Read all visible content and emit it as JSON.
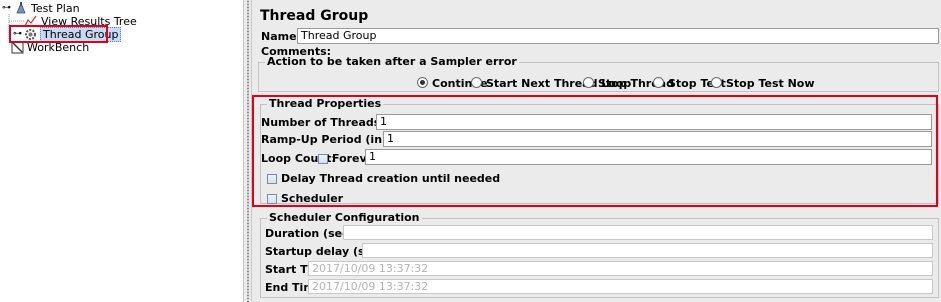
{
  "tree": {
    "test_plan": "Test Plan",
    "view_results_tree": "View Results Tree",
    "thread_group": "Thread Group",
    "workbench": "WorkBench"
  },
  "panel": {
    "title": "Thread Group",
    "name_label": "Name:",
    "name_value": "Thread Group",
    "comments_label": "Comments:"
  },
  "sampler_error": {
    "title": "Action to be taken after a Sampler error",
    "options": [
      "Continue",
      "Start Next Thread Loop",
      "Stop Thread",
      "Stop Test",
      "Stop Test Now"
    ],
    "selected": "Continue"
  },
  "thread_properties": {
    "title": "Thread Properties",
    "num_threads_label": "Number of Threads (users):",
    "num_threads_value": "1",
    "ramp_up_label": "Ramp-Up Period (in seconds):",
    "ramp_up_value": "1",
    "loop_count_label": "Loop Count:",
    "forever_label": "Forever",
    "forever_checked": false,
    "loop_count_value": "1",
    "delay_label": "Delay Thread creation until needed",
    "delay_checked": false,
    "scheduler_label": "Scheduler",
    "scheduler_checked": false
  },
  "scheduler_config": {
    "title": "Scheduler Configuration",
    "duration_label": "Duration (seconds)",
    "duration_value": "",
    "startup_delay_label": "Startup delay (seconds)",
    "startup_delay_value": "",
    "start_time_label": "Start Time",
    "start_time_value": "2017/10/09 13:37:32",
    "end_time_label": "End Time",
    "end_time_value": "2017/10/09 13:37:32"
  },
  "colors": {
    "highlight_border": "#e0001b",
    "selection_bg": "#c7d9f3"
  }
}
